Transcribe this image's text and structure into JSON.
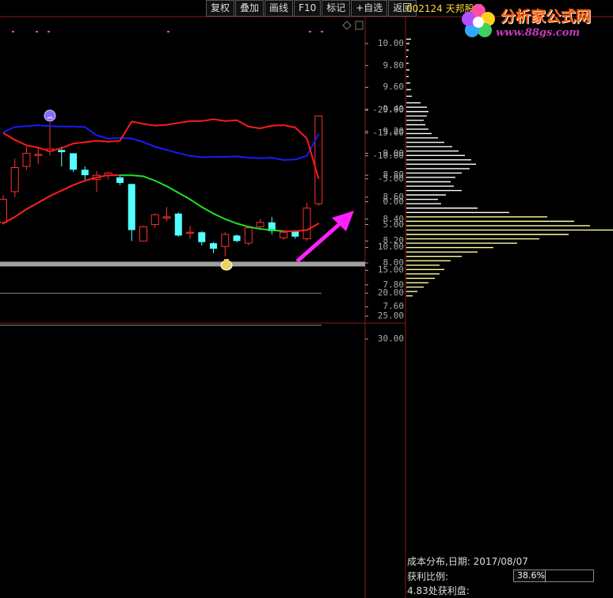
{
  "toolbar": {
    "buttons": [
      "复权",
      "叠加",
      "画线",
      "F10",
      "标记",
      "+自选",
      "返回"
    ]
  },
  "stock": {
    "code": "002124 天邦股份"
  },
  "logo": {
    "title": "分析家公式网",
    "url": "www.88gs.com"
  },
  "price_axis": {
    "labels": [
      "10.00",
      "9.80",
      "9.60",
      "9.40",
      "9.20",
      "9.00",
      "8.80",
      "8.60",
      "8.40",
      "8.20",
      "8.00",
      "7.80",
      "7.60"
    ],
    "values": [
      10.0,
      9.8,
      9.6,
      9.4,
      9.2,
      9.0,
      8.8,
      8.6,
      8.4,
      8.2,
      8.0,
      7.8,
      7.6
    ]
  },
  "indicator_axis": {
    "labels": [
      "30.00",
      "25.00",
      "20.00",
      "15.00",
      "10.00",
      "5.00",
      "0.00",
      "-5.00",
      "-10.00",
      "-15.00",
      "-20.00"
    ],
    "values": [
      30,
      25,
      20,
      15,
      10,
      5,
      0,
      -5,
      -10,
      -15,
      -20
    ]
  },
  "cost_panel": {
    "title": "成本分布,日期: 2017/08/07",
    "profit_ratio_label": "获利比例:",
    "profit_ratio_value": "38.6%",
    "profit_ratio": 0.386,
    "profit_at": "4.83处获利盘:"
  },
  "colors": {
    "up": "#ff3030",
    "down": "#54ffff",
    "ma_up": "#ff2020",
    "ma_down": "#20e020",
    "support": "#a0a0a0",
    "arrow": "#ff20ff",
    "chip": "#ffffa0",
    "chip_white": "#ffffff",
    "line_blue": "#1a1aff",
    "line_red": "#ff1a1a"
  },
  "chart_data": {
    "type": "candlestick",
    "candles": [
      {
        "o": 8.37,
        "c": 8.58,
        "h": 8.62,
        "l": 8.35
      },
      {
        "o": 8.65,
        "c": 8.87,
        "h": 8.95,
        "l": 8.6
      },
      {
        "o": 8.88,
        "c": 9.0,
        "h": 9.06,
        "l": 8.85
      },
      {
        "o": 8.98,
        "c": 8.99,
        "h": 9.05,
        "l": 8.9
      },
      {
        "o": 9.02,
        "c": 9.04,
        "h": 9.28,
        "l": 8.98
      },
      {
        "o": 9.03,
        "c": 9.01,
        "h": 9.06,
        "l": 8.88
      },
      {
        "o": 9.0,
        "c": 8.85,
        "h": 9.0,
        "l": 8.83
      },
      {
        "o": 8.85,
        "c": 8.8,
        "h": 8.88,
        "l": 8.76
      },
      {
        "o": 8.76,
        "c": 8.8,
        "h": 8.84,
        "l": 8.65
      },
      {
        "o": 8.8,
        "c": 8.82,
        "h": 8.83,
        "l": 8.76
      },
      {
        "o": 8.78,
        "c": 8.73,
        "h": 8.79,
        "l": 8.71
      },
      {
        "o": 8.72,
        "c": 8.3,
        "h": 8.72,
        "l": 8.2
      },
      {
        "o": 8.2,
        "c": 8.33,
        "h": 8.34,
        "l": 8.2
      },
      {
        "o": 8.35,
        "c": 8.44,
        "h": 8.45,
        "l": 8.32
      },
      {
        "o": 8.41,
        "c": 8.42,
        "h": 8.51,
        "l": 8.38
      },
      {
        "o": 8.45,
        "c": 8.25,
        "h": 8.46,
        "l": 8.24
      },
      {
        "o": 8.27,
        "c": 8.28,
        "h": 8.34,
        "l": 8.22
      },
      {
        "o": 8.28,
        "c": 8.19,
        "h": 8.29,
        "l": 8.16
      },
      {
        "o": 8.18,
        "c": 8.13,
        "h": 8.19,
        "l": 8.09
      },
      {
        "o": 8.15,
        "c": 8.26,
        "h": 8.28,
        "l": 8.06
      },
      {
        "o": 8.25,
        "c": 8.2,
        "h": 8.26,
        "l": 8.19
      },
      {
        "o": 8.18,
        "c": 8.32,
        "h": 8.32,
        "l": 8.16
      },
      {
        "o": 8.33,
        "c": 8.37,
        "h": 8.4,
        "l": 8.31
      },
      {
        "o": 8.37,
        "c": 8.29,
        "h": 8.42,
        "l": 8.26
      },
      {
        "o": 8.23,
        "c": 8.28,
        "h": 8.29,
        "l": 8.21
      },
      {
        "o": 8.29,
        "c": 8.24,
        "h": 8.3,
        "l": 8.22
      },
      {
        "o": 8.22,
        "c": 8.5,
        "h": 8.55,
        "l": 8.2
      },
      {
        "o": 8.54,
        "c": 9.34,
        "h": 9.34,
        "l": 8.52
      }
    ],
    "ma": [
      8.36,
      8.42,
      8.49,
      8.55,
      8.61,
      8.66,
      8.71,
      8.75,
      8.78,
      8.8,
      8.8,
      8.8,
      8.79,
      8.75,
      8.7,
      8.64,
      8.58,
      8.51,
      8.45,
      8.4,
      8.36,
      8.33,
      8.31,
      8.3,
      8.29,
      8.29,
      8.3,
      8.36
    ],
    "ma_trend": [
      "up",
      "up",
      "up",
      "up",
      "up",
      "up",
      "up",
      "up",
      "up",
      "up",
      "up",
      "down",
      "down",
      "down",
      "down",
      "down",
      "down",
      "down",
      "down",
      "down",
      "down",
      "down",
      "down",
      "down",
      "down",
      "up",
      "up",
      "up"
    ],
    "support_level": 7.99,
    "indicator_guides": [
      27.0,
      20.0
    ],
    "blue_line": [
      -15.2,
      -16.3,
      -16.5,
      -16.7,
      -16.5,
      -16.4,
      -16.4,
      -16.3,
      -14.5,
      -13.8,
      -13.9,
      -13.8,
      -13.0,
      -12.0,
      -11.3,
      -10.6,
      -10.0,
      -9.7,
      -9.8,
      -9.8,
      -9.9,
      -9.6,
      -9.5,
      -9.6,
      -9.1,
      -9.2,
      -10.0,
      -14.8
    ],
    "red_line": [
      -15.0,
      -13.5,
      -12.3,
      -11.8,
      -11.0,
      -11.7,
      -12.7,
      -13.0,
      -13.3,
      -13.1,
      -13.3,
      -17.5,
      -17.0,
      -16.6,
      -16.8,
      -17.2,
      -17.6,
      -17.6,
      -18.0,
      -17.6,
      -17.8,
      -16.4,
      -16.0,
      -16.6,
      -16.7,
      -16.2,
      -13.8,
      -5.0
    ],
    "chips": [
      {
        "p": 10.04,
        "w": 6
      },
      {
        "p": 10.0,
        "w": 4
      },
      {
        "p": 9.94,
        "w": 3
      },
      {
        "p": 9.88,
        "w": 2
      },
      {
        "p": 9.82,
        "w": 3
      },
      {
        "p": 9.76,
        "w": 4
      },
      {
        "p": 9.7,
        "w": 3
      },
      {
        "p": 9.64,
        "w": 5
      },
      {
        "p": 9.58,
        "w": 6
      },
      {
        "p": 9.52,
        "w": 7
      },
      {
        "p": 9.46,
        "w": 18
      },
      {
        "p": 9.42,
        "w": 26
      },
      {
        "p": 9.38,
        "w": 28
      },
      {
        "p": 9.34,
        "w": 26
      },
      {
        "p": 9.3,
        "w": 22
      },
      {
        "p": 9.26,
        "w": 24
      },
      {
        "p": 9.22,
        "w": 28
      },
      {
        "p": 9.18,
        "w": 32
      },
      {
        "p": 9.14,
        "w": 40
      },
      {
        "p": 9.1,
        "w": 48
      },
      {
        "p": 9.06,
        "w": 58
      },
      {
        "p": 9.02,
        "w": 66
      },
      {
        "p": 8.98,
        "w": 74
      },
      {
        "p": 8.94,
        "w": 82
      },
      {
        "p": 8.9,
        "w": 88
      },
      {
        "p": 8.86,
        "w": 80
      },
      {
        "p": 8.82,
        "w": 70
      },
      {
        "p": 8.78,
        "w": 62
      },
      {
        "p": 8.74,
        "w": 56
      },
      {
        "p": 8.7,
        "w": 60
      },
      {
        "p": 8.66,
        "w": 70
      },
      {
        "p": 8.62,
        "w": 50
      },
      {
        "p": 8.58,
        "w": 40
      },
      {
        "p": 8.54,
        "w": 44
      },
      {
        "p": 8.5,
        "w": 90
      },
      {
        "p": 8.46,
        "w": 130
      },
      {
        "p": 8.42,
        "w": 178
      },
      {
        "p": 8.38,
        "w": 212
      },
      {
        "p": 8.34,
        "w": 232
      },
      {
        "p": 8.3,
        "w": 262
      },
      {
        "p": 8.26,
        "w": 205
      },
      {
        "p": 8.22,
        "w": 168
      },
      {
        "p": 8.18,
        "w": 140
      },
      {
        "p": 8.14,
        "w": 110
      },
      {
        "p": 8.1,
        "w": 90
      },
      {
        "p": 8.06,
        "w": 70
      },
      {
        "p": 8.02,
        "w": 56
      },
      {
        "p": 7.98,
        "w": 42
      },
      {
        "p": 7.94,
        "w": 48
      },
      {
        "p": 7.9,
        "w": 42
      },
      {
        "p": 7.86,
        "w": 36
      },
      {
        "p": 7.82,
        "w": 28
      },
      {
        "p": 7.78,
        "w": 22
      },
      {
        "p": 7.74,
        "w": 14
      },
      {
        "p": 7.7,
        "w": 8
      }
    ]
  }
}
